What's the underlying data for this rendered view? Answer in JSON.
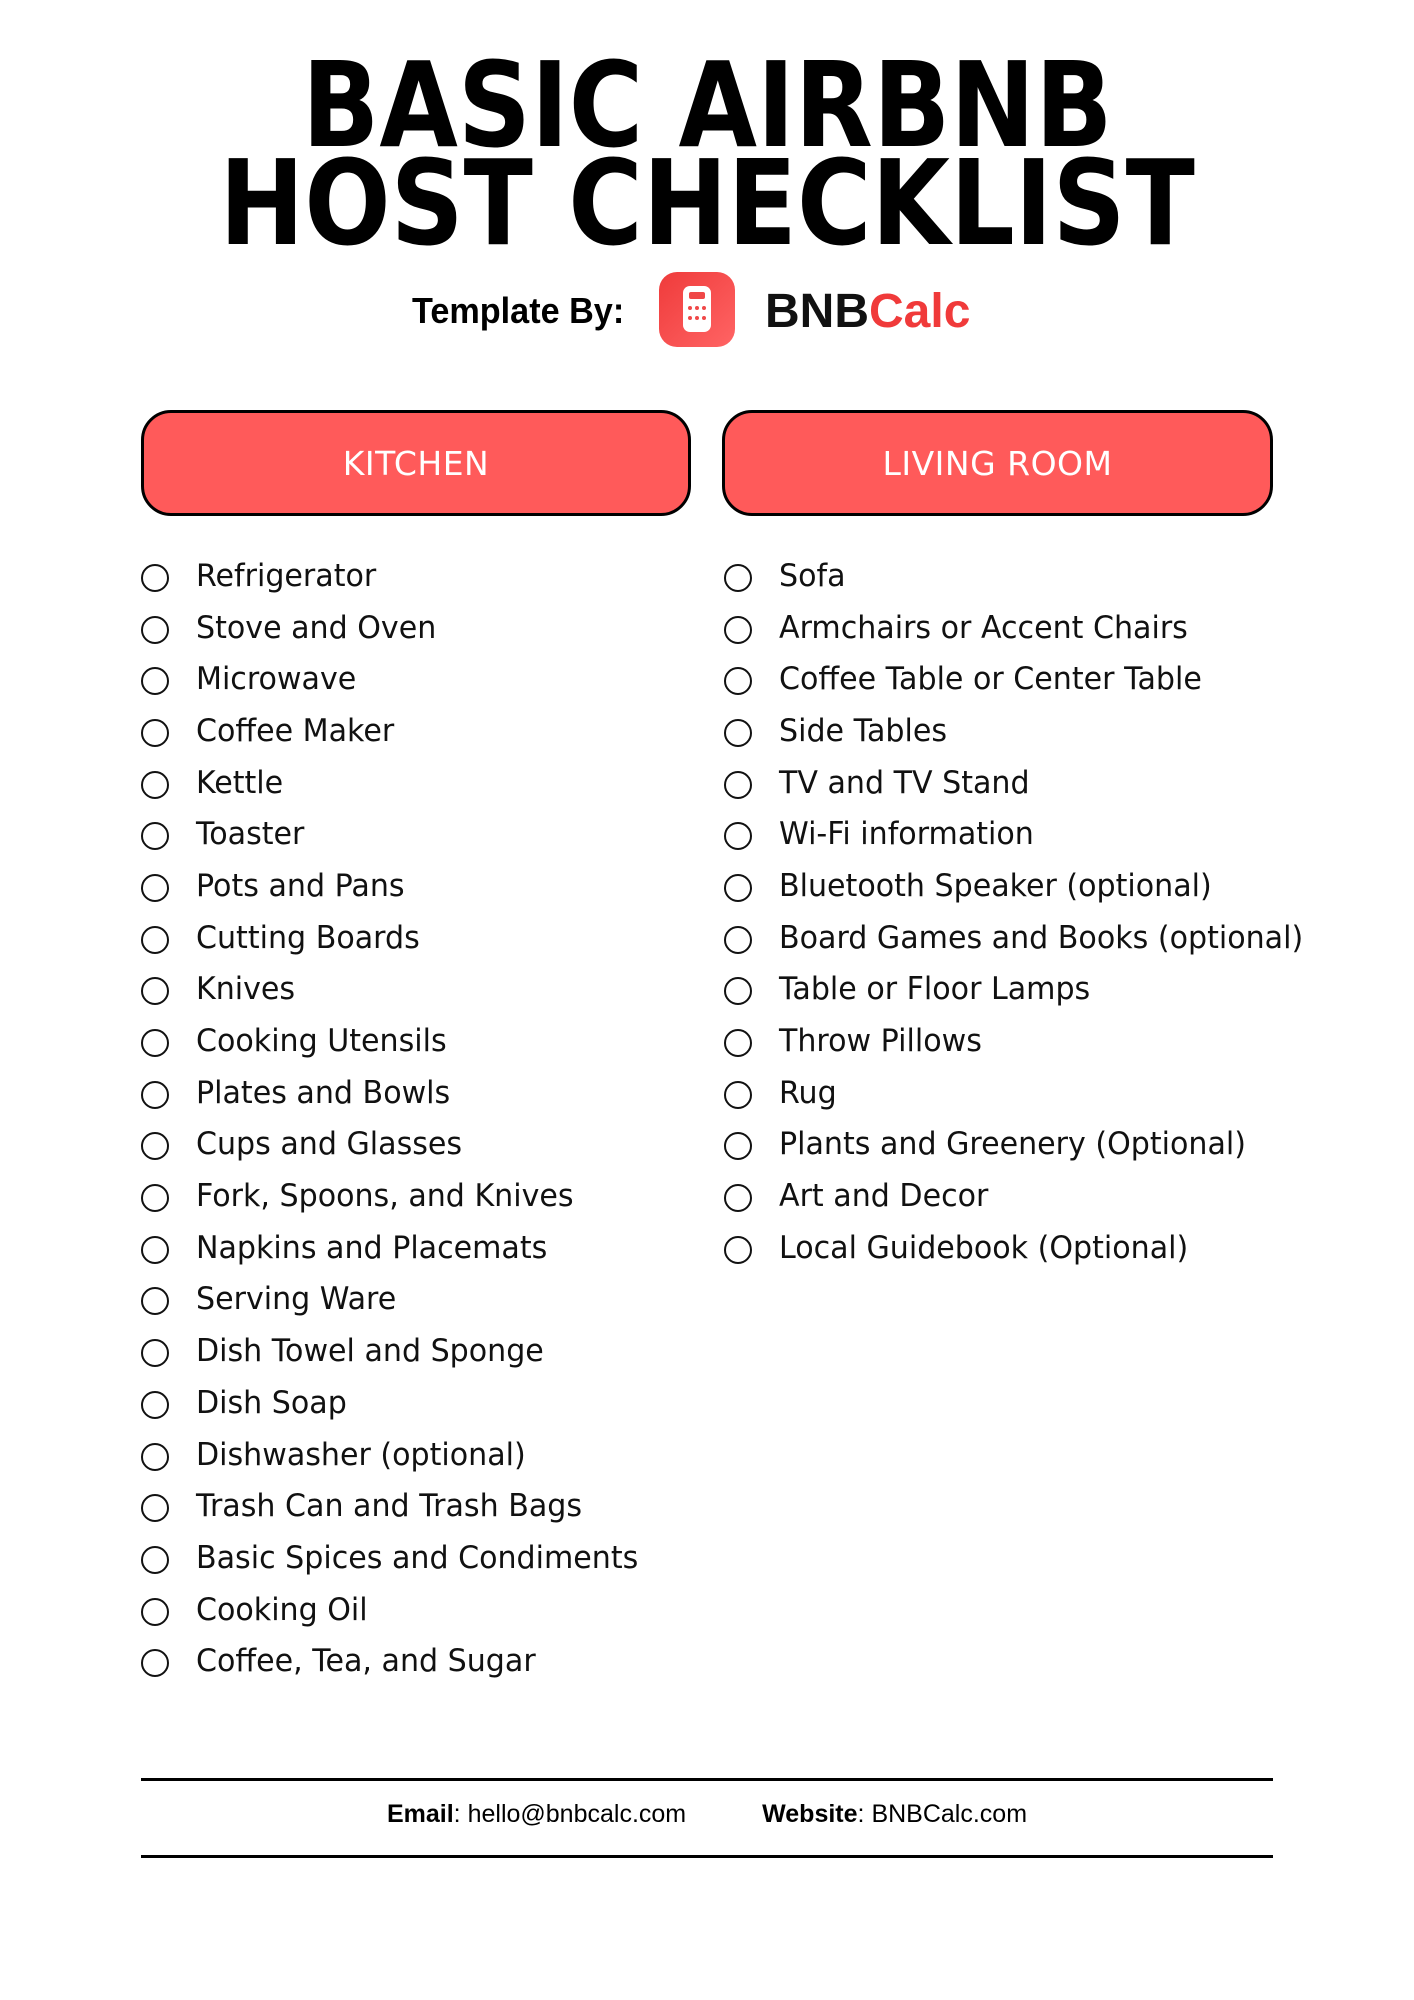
{
  "title": {
    "line1": "BASIC AIRBNB",
    "line2": "HOST CHECKLIST"
  },
  "byline": {
    "label": "Template By:",
    "logo_icon": "calculator-icon",
    "brand_part1": "BNB",
    "brand_part2": "Calc"
  },
  "colors": {
    "accent": "#ff5a5a",
    "brand_red": "#f03a3a",
    "text": "#111111"
  },
  "sections": [
    {
      "heading": "KITCHEN",
      "items": [
        "Refrigerator",
        "Stove and Oven",
        "Microwave",
        "Coffee Maker",
        "Kettle",
        "Toaster",
        "Pots and Pans",
        "Cutting Boards",
        "Knives",
        "Cooking Utensils",
        "Plates and Bowls",
        "Cups and Glasses",
        "Fork, Spoons, and Knives",
        "Napkins and Placemats",
        "Serving Ware",
        "Dish Towel and Sponge",
        "Dish Soap",
        "Dishwasher (optional)",
        "Trash Can and Trash Bags",
        "Basic Spices and Condiments",
        "Cooking Oil",
        "Coffee, Tea, and Sugar"
      ]
    },
    {
      "heading": "LIVING ROOM",
      "items": [
        "Sofa",
        "Armchairs or Accent Chairs",
        "Coffee Table or Center Table",
        "Side Tables",
        "TV and TV Stand",
        "Wi-Fi information",
        "Bluetooth Speaker (optional)",
        "Board Games and Books (optional)",
        "Table or Floor Lamps",
        "Throw Pillows",
        "Rug",
        "Plants and Greenery (Optional)",
        "Art and Decor",
        "Local Guidebook (Optional)"
      ]
    }
  ],
  "footer": {
    "email_label": "Email",
    "email_value": "hello@bnbcalc.com",
    "website_label": "Website",
    "website_value": "BNBCalc.com"
  }
}
